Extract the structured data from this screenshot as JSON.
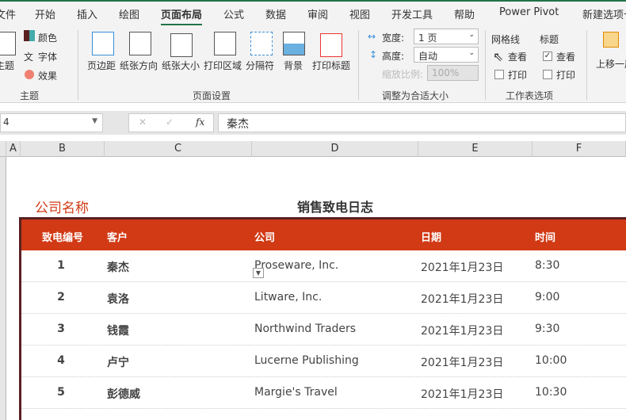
{
  "tabs": [
    "文件",
    "开始",
    "插入",
    "绘图",
    "页面布局",
    "公式",
    "数据",
    "审阅",
    "视图",
    "开发工具",
    "帮助",
    "Power Pivot",
    "新建选项卡"
  ],
  "ribbon": {
    "theme": {
      "themes": "主题",
      "colors": "颜色",
      "fonts": "字体",
      "effects": "效果",
      "group": "主题"
    },
    "page_setup": {
      "margins": "页边距",
      "orientation": "纸张方向",
      "size": "纸张大小",
      "print_area": "打印区域",
      "breaks": "分隔符",
      "background": "背景",
      "print_titles": "打印标题",
      "group": "页面设置"
    },
    "scale": {
      "width_label": "宽度:",
      "width_value": "1 页",
      "height_label": "高度:",
      "height_value": "自动",
      "scale_label": "缩放比例:",
      "scale_value": "100%",
      "group": "调整为合适大小"
    },
    "sheet_options": {
      "gridlines": "网格线",
      "headings": "标题",
      "view": "查看",
      "print": "打印",
      "group": "工作表选项",
      "headings_view_checked": true
    },
    "arrange": {
      "bring_forward": "上移一层"
    }
  },
  "formula_bar": {
    "name_box": "4",
    "fx": "fx",
    "value": "秦杰"
  },
  "columns": [
    "A",
    "B",
    "C",
    "D",
    "E",
    "F"
  ],
  "sheet": {
    "company": "公司名称",
    "title": "销售致电日志",
    "headers": [
      "致电编号",
      "客户",
      "公司",
      "日期",
      "时间"
    ],
    "rows": [
      [
        "1",
        "秦杰",
        "Proseware, Inc.",
        "2021年1月23日",
        "8:30"
      ],
      [
        "2",
        "袁洛",
        "Litware, Inc.",
        "2021年1月23日",
        "9:00"
      ],
      [
        "3",
        "钱霞",
        "Northwind Traders",
        "2021年1月23日",
        "9:30"
      ],
      [
        "4",
        "卢宁",
        "Lucerne Publishing",
        "2021年1月23日",
        "10:00"
      ],
      [
        "5",
        "彭德威",
        "Margie's Travel",
        "2021年1月23日",
        "10:30"
      ]
    ]
  },
  "colors": {
    "accent": "#217346",
    "header": "#d13a15"
  }
}
